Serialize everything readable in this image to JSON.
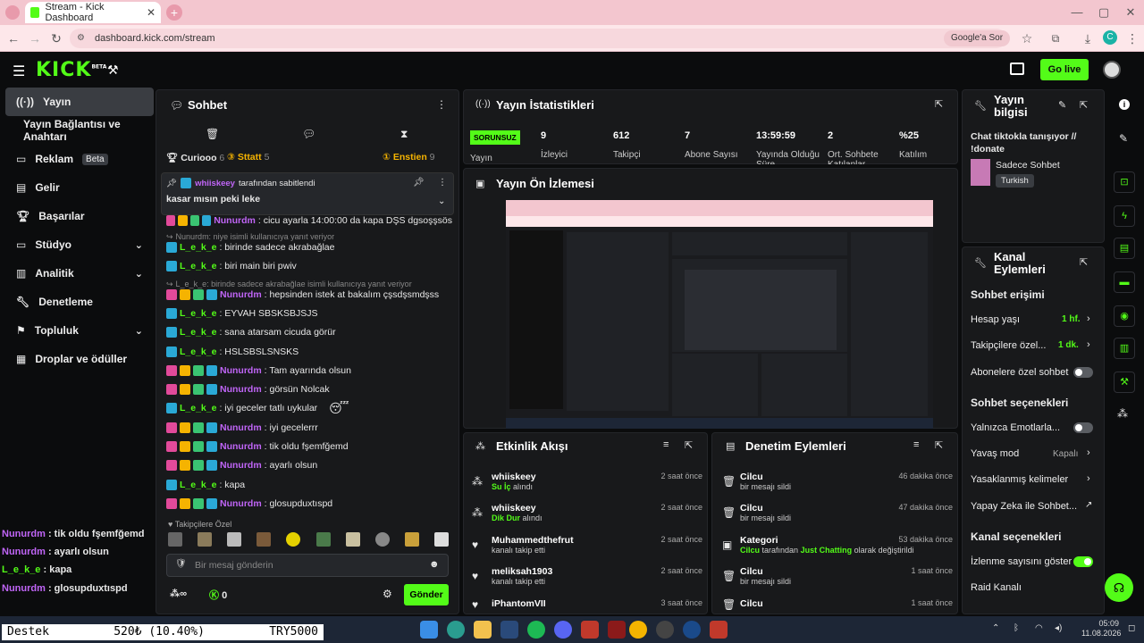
{
  "browser": {
    "tab_title": "Stream - Kick Dashboard",
    "url": "dashboard.kick.com/stream",
    "google_search": "Google'a Sor",
    "profile_initial": "C"
  },
  "header": {
    "logo": "KICK",
    "logo_badge": "BETA",
    "go_live": "Go live"
  },
  "sidebar": {
    "items": [
      {
        "label": "Yayın",
        "icon": "broadcast-icon"
      },
      {
        "label": "Yayın Bağlantısı ve Anahtarı"
      },
      {
        "label": "Reklam",
        "badge": "Beta",
        "icon": "ad-icon"
      },
      {
        "label": "Gelir",
        "icon": "revenue-icon"
      },
      {
        "label": "Başarılar",
        "icon": "trophy-icon"
      },
      {
        "label": "Stüdyo",
        "icon": "studio-icon"
      },
      {
        "label": "Analitik",
        "icon": "analytics-icon"
      },
      {
        "label": "Denetleme",
        "icon": "wrench-icon"
      },
      {
        "label": "Topluluk",
        "icon": "community-icon"
      },
      {
        "label": "Droplar ve ödüller",
        "icon": "drops-icon"
      }
    ]
  },
  "chat": {
    "title": "Sohbet",
    "leaders": [
      {
        "name": "Curiooo",
        "count": "6"
      },
      {
        "name": "Sttatt",
        "count": "5"
      },
      {
        "name": "Enstien",
        "count": "9"
      }
    ],
    "pinned_by": "whiiskeey",
    "pinned_suffix": "tarafından sabitlendi",
    "pinned_msg": "kasar mısın peki leke",
    "messages": [
      {
        "user": "Nunurdm",
        "text": ": cicu ayarla 14:00:00 da kapa DŞS dgsoşşsös",
        "kind": "u1"
      },
      {
        "reply": "Nunurdm: niye isimli kullanıcıya yanıt veriyor"
      },
      {
        "user": "L_e_k_e",
        "text": ": birinde sadece akrabağlae",
        "kind": "u2"
      },
      {
        "user": "L_e_k_e",
        "text": ": biri main biri pwiv",
        "kind": "u2"
      },
      {
        "reply": "L_e_k_e: birinde sadece akrabağlae isimli kullanıcıya yanıt veriyor"
      },
      {
        "user": "Nunurdm",
        "text": ": hepsinden istek at bakalım çşsdşsmdşss",
        "kind": "u1"
      },
      {
        "user": "L_e_k_e",
        "text": ": EYVAH SBSKSBJSJS",
        "kind": "u2"
      },
      {
        "user": "L_e_k_e",
        "text": ": sana atarsam cicuda görür",
        "kind": "u2"
      },
      {
        "user": "L_e_k_e",
        "text": ": HSLSBSLSNSKS",
        "kind": "u2"
      },
      {
        "user": "Nunurdm",
        "text": ": Tam ayarında olsun",
        "kind": "u1"
      },
      {
        "user": "Nunurdm",
        "text": ": görsün Nolcak",
        "kind": "u1"
      },
      {
        "user": "L_e_k_e",
        "text": ": iyi geceler tatlı uykular",
        "kind": "u2"
      },
      {
        "user": "Nunurdm",
        "text": ": iyi gecelerrr",
        "kind": "u1"
      },
      {
        "user": "Nunurdm",
        "text": ": tik oldu fşemfğemd",
        "kind": "u1"
      },
      {
        "user": "Nunurdm",
        "text": ": ayarlı olsun",
        "kind": "u1"
      },
      {
        "user": "L_e_k_e",
        "text": ": kapa",
        "kind": "u2"
      },
      {
        "user": "Nunurdm",
        "text": ": glosupduxtıspd",
        "kind": "u1"
      }
    ],
    "followers_only": "Takipçilere Özel",
    "input_placeholder": "Bir mesaj gönderin",
    "infinity": "∞",
    "count": "0",
    "send": "Gönder"
  },
  "stats": {
    "title": "Yayın İstatistikleri",
    "status": "SORUNSUZ",
    "items": [
      {
        "value": "9",
        "label": "İzleyici"
      },
      {
        "value": "612",
        "label": "Takipçi"
      },
      {
        "value": "7",
        "label": "Abone Sayısı"
      },
      {
        "value": "13:59:59",
        "label": "Yayında Olduğu Süre"
      },
      {
        "value": "2",
        "label": "Ort. Sohbete Katılanlar"
      },
      {
        "value": "%25",
        "label": "Katılım"
      }
    ],
    "yayin_label": "Yayın"
  },
  "preview": {
    "title": "Yayın Ön İzlemesi"
  },
  "feed": {
    "title": "Etkinlik Akışı",
    "items": [
      {
        "user": "whiiskeey",
        "sub": "Su İç",
        "sub2": " alındı",
        "time": "2 saat önce"
      },
      {
        "user": "whiiskeey",
        "sub": "Dik Dur",
        "sub2": " alındı",
        "time": "2 saat önce"
      },
      {
        "user": "Muhammedthefrut",
        "sub": "",
        "sub2": "kanalı takip etti",
        "time": "2 saat önce"
      },
      {
        "user": "meliksah1903",
        "sub": "",
        "sub2": "kanalı takip etti",
        "time": "2 saat önce"
      },
      {
        "user": "iPhantomVII",
        "sub": "",
        "sub2": "",
        "time": "3 saat önce"
      }
    ]
  },
  "mod": {
    "title": "Denetim Eylemleri",
    "items": [
      {
        "user": "Cilcu",
        "desc": "bir mesajı sildi",
        "time": "46 dakika önce"
      },
      {
        "user": "Cilcu",
        "desc": "bir mesajı sildi",
        "time": "47 dakika önce"
      },
      {
        "user": "Kategori",
        "desc_a": "Cilcu",
        "desc_b": " tarafından ",
        "desc_c": "Just Chatting",
        "desc_d": " olarak değiştirildi",
        "time": "53 dakika önce"
      },
      {
        "user": "Cilcu",
        "desc": "bir mesajı sildi",
        "time": "1 saat önce"
      },
      {
        "user": "Cilcu",
        "desc": "",
        "time": "1 saat önce"
      }
    ]
  },
  "info": {
    "title": "Yayın bilgisi",
    "stream_title": "Chat tiktokla tanışıyor // !donate",
    "category": "Sadece Sohbet",
    "language": "Turkish"
  },
  "channel": {
    "title": "Kanal Eylemleri",
    "chat_access": "Sohbet erişimi",
    "account_age": "Hesap yaşı",
    "account_age_val": "1 hf.",
    "followers_only": "Takipçilere özel...",
    "followers_only_val": "1 dk.",
    "subs_only": "Abonelere özel sohbet",
    "chat_options": "Sohbet seçenekleri",
    "emotes_only": "Yalnızca Emotlarla...",
    "slow_mode": "Yavaş mod",
    "slow_mode_val": "Kapalı",
    "banned_words": "Yasaklanmış kelimeler",
    "ai_chat": "Yapay Zeka ile Sohbet...",
    "channel_options": "Kanal seçenekleri",
    "show_viewers": "İzlenme sayısını göster",
    "raid": "Raid Kanalı"
  },
  "overlay_chat": [
    {
      "user": "Nunurdm",
      "text": " : tik oldu fşemfğemd"
    },
    {
      "user": "Nunurdm",
      "text": " : ayarlı olsun"
    },
    {
      "user": "L_e_k_e",
      "text": " : kapa"
    },
    {
      "user": "Nunurdm",
      "text": " : glosupduxtıspd"
    }
  ],
  "ticker": {
    "left": "Destek",
    "mid": "520₺ (10.40%)",
    "right": "TRY5000"
  },
  "clock": {
    "time": "05:09",
    "date": "11.08.2026"
  },
  "colors": {
    "kick_green": "#53fc18",
    "purple_user": "#c065f7",
    "panel": "#18191b"
  }
}
